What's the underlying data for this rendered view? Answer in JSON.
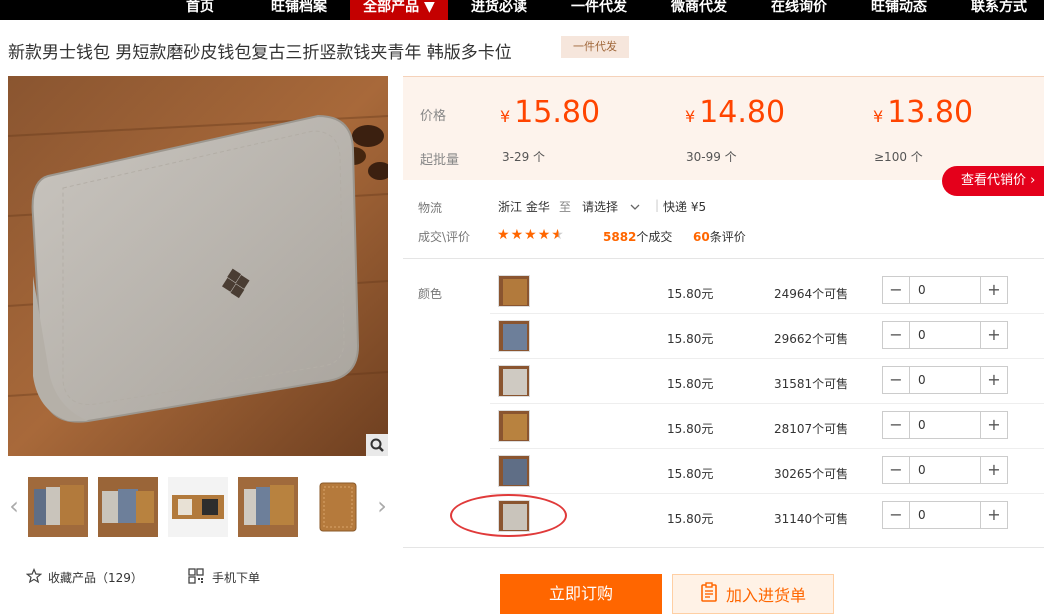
{
  "nav": {
    "items": [
      "首页",
      "旺铺档案",
      "全部产品 ▼",
      "进货必读",
      "一件代发",
      "微商代发",
      "在线询价",
      "旺铺动态",
      "联系方式"
    ]
  },
  "product": {
    "title": "新款男士钱包 男短款磨砂皮钱包复古三折竖款钱夹青年 韩版多卡位",
    "tag": "一件代发"
  },
  "pricing": {
    "price_label": "价格",
    "moq_label": "起批量",
    "currency": "¥",
    "tiers": [
      {
        "price": "15.80",
        "range": "3-29 个"
      },
      {
        "price": "14.80",
        "range": "30-99 个"
      },
      {
        "price": "13.80",
        "range": "≥100 个"
      }
    ],
    "see_button": "查看代销价"
  },
  "logistics": {
    "label": "物流",
    "origin": "浙江 金华",
    "to": "至",
    "dest": "请选择",
    "express": "快递 ¥5"
  },
  "deals": {
    "label": "成交\\评价",
    "rating_stars": 4.5,
    "count": "5882",
    "count_suffix": "个成交",
    "reviews": "60",
    "reviews_suffix": "条评价"
  },
  "sku": {
    "label": "颜色",
    "rows": [
      {
        "price": "15.80元",
        "stock": "24964个可售",
        "qty": "0",
        "color": "#b27a3c"
      },
      {
        "price": "15.80元",
        "stock": "29662个可售",
        "qty": "0",
        "color": "#6d7f9a"
      },
      {
        "price": "15.80元",
        "stock": "31581个可售",
        "qty": "0",
        "color": "#cfcac2"
      },
      {
        "price": "15.80元",
        "stock": "28107个可售",
        "qty": "0",
        "color": "#b8823f"
      },
      {
        "price": "15.80元",
        "stock": "30265个可售",
        "qty": "0",
        "color": "#5f6e86"
      },
      {
        "price": "15.80元",
        "stock": "31140个可售",
        "qty": "0",
        "color": "#c9c4bb"
      }
    ]
  },
  "actions": {
    "favorite": "收藏产品（129）",
    "mobile_order": "手机下单",
    "buy_now": "立即订购",
    "add_to_cart": "加入进货单"
  },
  "colors": {
    "accent": "#ff6600",
    "price": "#ff4400",
    "nav_active": "#c40000",
    "see_button": "#e4001b"
  }
}
